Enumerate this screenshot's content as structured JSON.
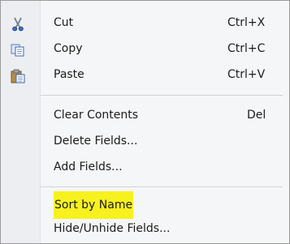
{
  "menu": {
    "items": [
      {
        "label": "Cut",
        "shortcut": "Ctrl+X",
        "icon": "scissors-icon"
      },
      {
        "label": "Copy",
        "shortcut": "Ctrl+C",
        "icon": "copy-icon"
      },
      {
        "label": "Paste",
        "shortcut": "Ctrl+V",
        "icon": "paste-icon"
      },
      {
        "label": "Clear Contents",
        "shortcut": "Del"
      },
      {
        "label": "Delete Fields...",
        "shortcut": ""
      },
      {
        "label": "Add Fields...",
        "shortcut": ""
      },
      {
        "label": "Sort by Name",
        "shortcut": "",
        "highlighted": true
      },
      {
        "label": "Hide/Unhide Fields...",
        "shortcut": ""
      }
    ]
  },
  "colors": {
    "highlight": "#f7f11f",
    "menu_background": "#f5f6f7",
    "gutter_background": "#eceef1",
    "border": "#9a9a9a"
  }
}
